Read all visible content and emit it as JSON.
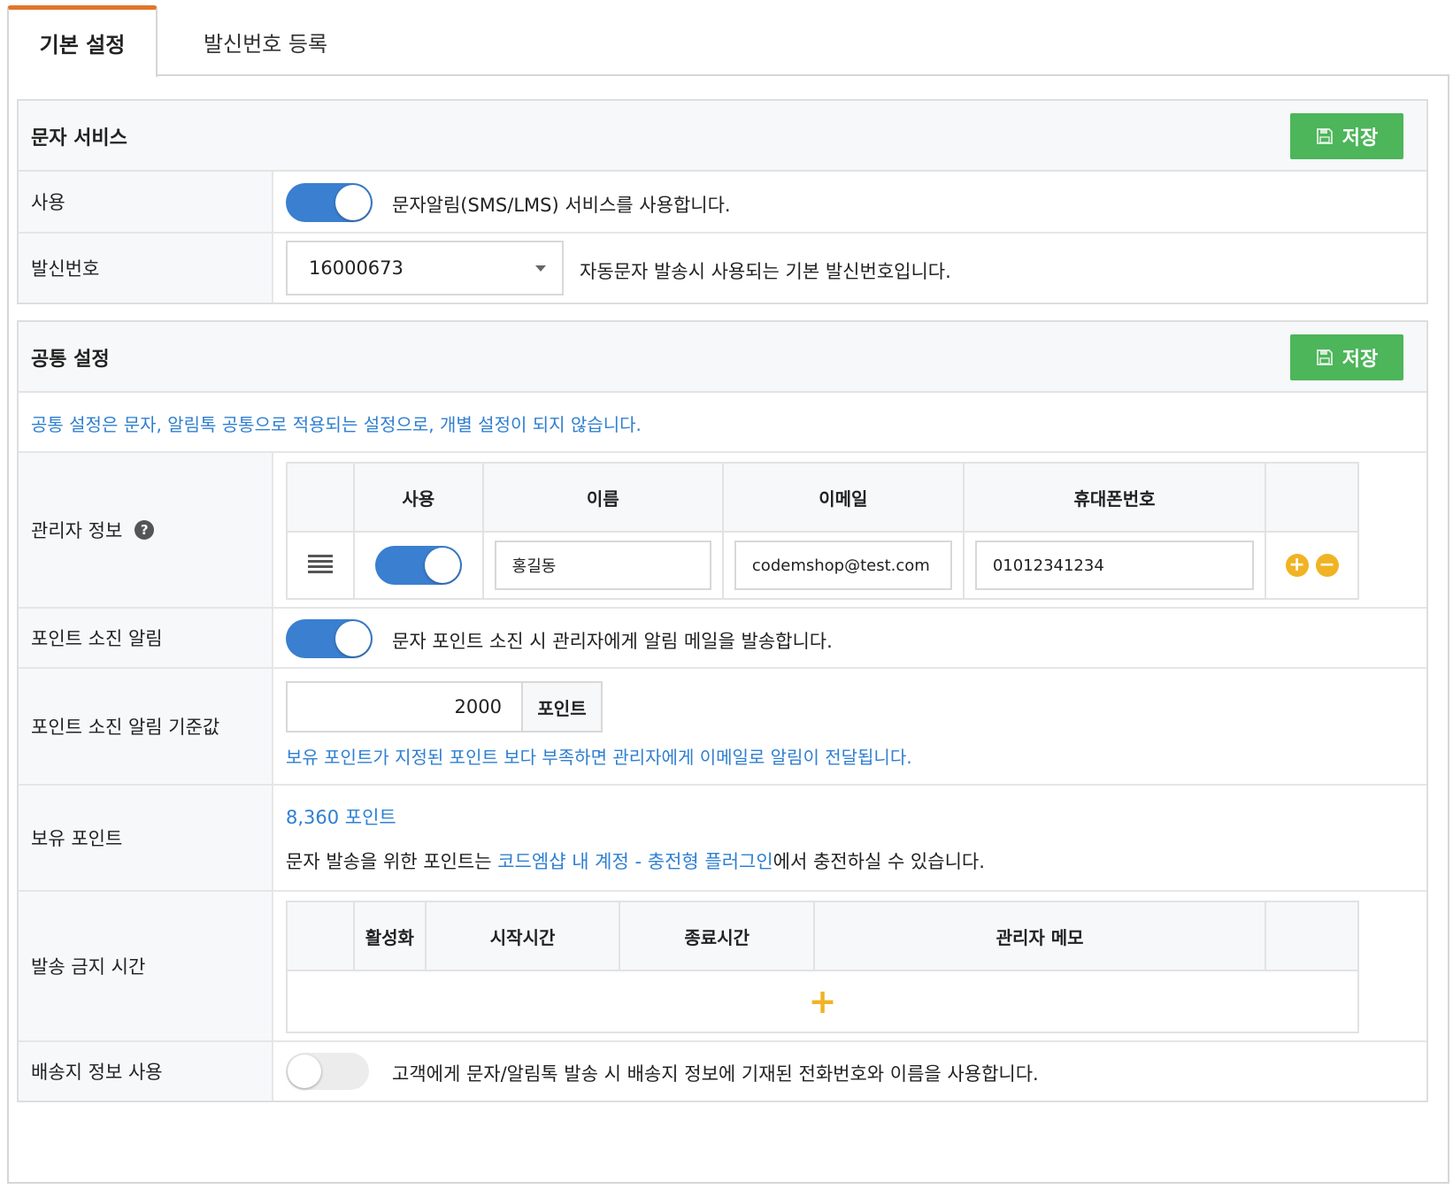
{
  "tabs": [
    {
      "label": "기본 설정",
      "active": true
    },
    {
      "label": "발신번호 등록",
      "active": false
    }
  ],
  "colors": {
    "accent_tab": "#e0772b",
    "save_button": "#4db55a",
    "toggle_on": "#3a7fd0",
    "link_blue": "#2f7fd1",
    "add_button": "#f0b323"
  },
  "sms_service": {
    "title": "문자 서비스",
    "save_label": "저장",
    "use": {
      "label": "사용",
      "enabled": true,
      "description": "문자알림(SMS/LMS) 서비스를 사용합니다."
    },
    "sender": {
      "label": "발신번호",
      "selected": "16000673",
      "description": "자동문자 발송시 사용되는 기본 발신번호입니다."
    }
  },
  "common": {
    "title": "공통 설정",
    "save_label": "저장",
    "notice": "공통 설정은 문자, 알림톡 공통으로 적용되는 설정으로, 개별 설정이 되지 않습니다.",
    "admin": {
      "label": "관리자 정보",
      "columns": [
        "사용",
        "이름",
        "이메일",
        "휴대폰번호"
      ],
      "rows": [
        {
          "enabled": true,
          "name": "홍길동",
          "email": "codemshop@test.com",
          "phone": "01012341234"
        }
      ]
    },
    "point_alert": {
      "label": "포인트 소진 알림",
      "enabled": true,
      "description": "문자 포인트 소진 시 관리자에게 알림 메일을 발송합니다."
    },
    "point_threshold": {
      "label": "포인트 소진 알림 기준값",
      "value": "2000",
      "unit": "포인트",
      "help": "보유 포인트가 지정된 포인트 보다 부족하면 관리자에게 이메일로 알림이 전달됩니다."
    },
    "owned_points": {
      "label": "보유 포인트",
      "value": "8,360 포인트",
      "desc_before": "문자 발송을 위한 포인트는 ",
      "link": "코드엠샵 내 계정 - 충전형 플러그인",
      "desc_after": "에서 충전하실 수 있습니다."
    },
    "blackout": {
      "label": "발송 금지 시간",
      "columns": [
        "활성화",
        "시작시간",
        "종료시간",
        "관리자 메모"
      ],
      "add_symbol": "+"
    },
    "shipping_info": {
      "label": "배송지 정보 사용",
      "enabled": false,
      "description": "고객에게 문자/알림톡 발송 시 배송지 정보에 기재된 전화번호와 이름을 사용합니다."
    }
  }
}
